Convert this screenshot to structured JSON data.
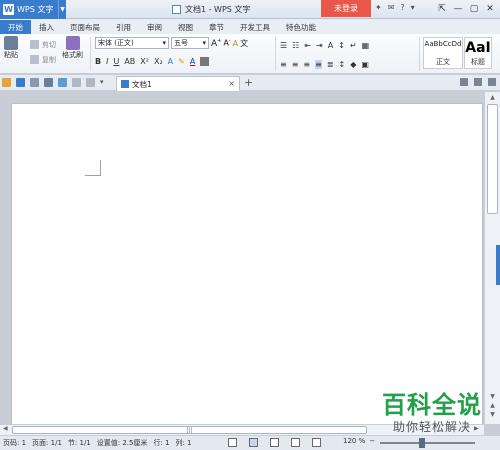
{
  "app": {
    "name": "WPS 文字",
    "title": "文档1 - WPS 文字",
    "login_label": "未登录"
  },
  "tabs": [
    "开始",
    "插入",
    "页面布局",
    "引用",
    "审阅",
    "视图",
    "章节",
    "开发工具",
    "特色功能"
  ],
  "ribbon": {
    "paste_label": "粘贴",
    "cut_label": "剪切",
    "copy_label": "复制",
    "format_painter_label": "格式刷",
    "font_name": "宋体 (正文)",
    "font_size": "五号",
    "styles": [
      {
        "sample": "AaBbCcDd",
        "label": "正文"
      },
      {
        "sample": "AaI",
        "label": "标题"
      }
    ]
  },
  "document_tab": {
    "name": "文档1"
  },
  "status": {
    "page": "页码: 1",
    "pages": "页面: 1/1",
    "section": "节: 1/1",
    "setting": "设置值: 2.5厘米",
    "row": "行: 1",
    "col": "列: 1",
    "zoom": "120 %"
  },
  "watermark": {
    "line1": "百科全说",
    "line2": "助你轻松解决"
  },
  "colors": {
    "accent": "#3a7ccc",
    "login": "#e8574a",
    "watermark": "#22a04a"
  }
}
